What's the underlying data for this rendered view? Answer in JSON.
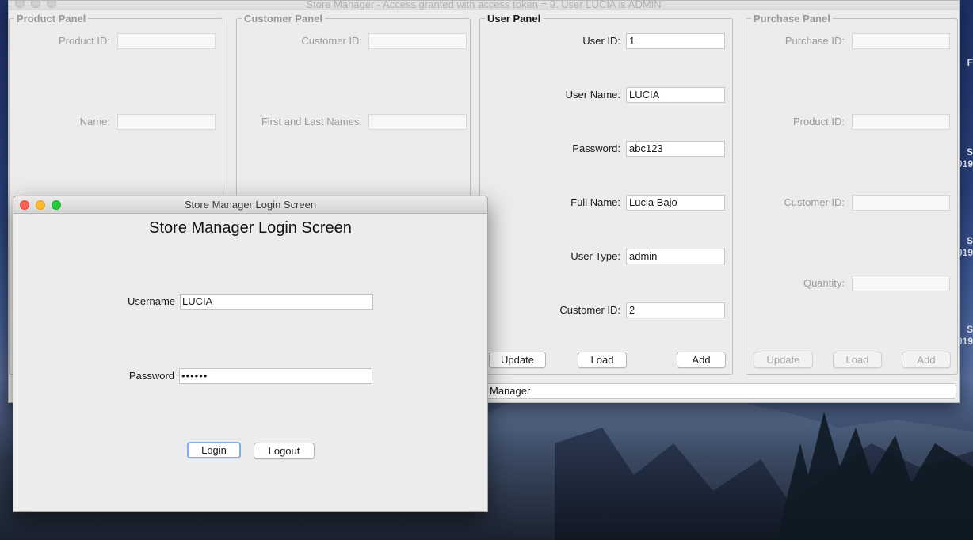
{
  "desktop": {
    "right_edge_labels": [
      "F",
      "S",
      "019",
      "S",
      "019",
      "S",
      "019"
    ]
  },
  "main_window": {
    "title": "Store Manager - Access granted with access token = 9. User LUCIA is ADMIN",
    "status_text": "Manager"
  },
  "product_panel": {
    "title": "Product Panel",
    "fields": [
      {
        "label": "Product ID:",
        "value": ""
      },
      {
        "label": "Name:",
        "value": ""
      }
    ]
  },
  "customer_panel": {
    "title": "Customer Panel",
    "fields": [
      {
        "label": "Customer ID:",
        "value": ""
      },
      {
        "label": "First and Last Names:",
        "value": ""
      }
    ]
  },
  "user_panel": {
    "title": "User Panel",
    "fields": [
      {
        "label": "User ID:",
        "value": "1"
      },
      {
        "label": "User Name:",
        "value": "LUCIA"
      },
      {
        "label": "Password:",
        "value": "abc123"
      },
      {
        "label": "Full Name:",
        "value": "Lucia Bajo"
      },
      {
        "label": "User Type:",
        "value": "admin"
      },
      {
        "label": "Customer ID:",
        "value": "2"
      }
    ],
    "buttons": {
      "update": "Update",
      "load": "Load",
      "add": "Add"
    }
  },
  "purchase_panel": {
    "title": "Purchase Panel",
    "fields": [
      {
        "label": "Purchase ID:",
        "value": ""
      },
      {
        "label": "Product ID:",
        "value": ""
      },
      {
        "label": "Customer ID:",
        "value": ""
      },
      {
        "label": "Quantity:",
        "value": ""
      }
    ],
    "buttons": {
      "update": "Update",
      "load": "Load",
      "add": "Add"
    }
  },
  "login_window": {
    "title": "Store Manager Login Screen",
    "heading": "Store Manager Login Screen",
    "username_label": "Username",
    "username_value": "LUCIA",
    "password_label": "Password",
    "password_value": "••••••",
    "login_button": "Login",
    "logout_button": "Logout"
  }
}
